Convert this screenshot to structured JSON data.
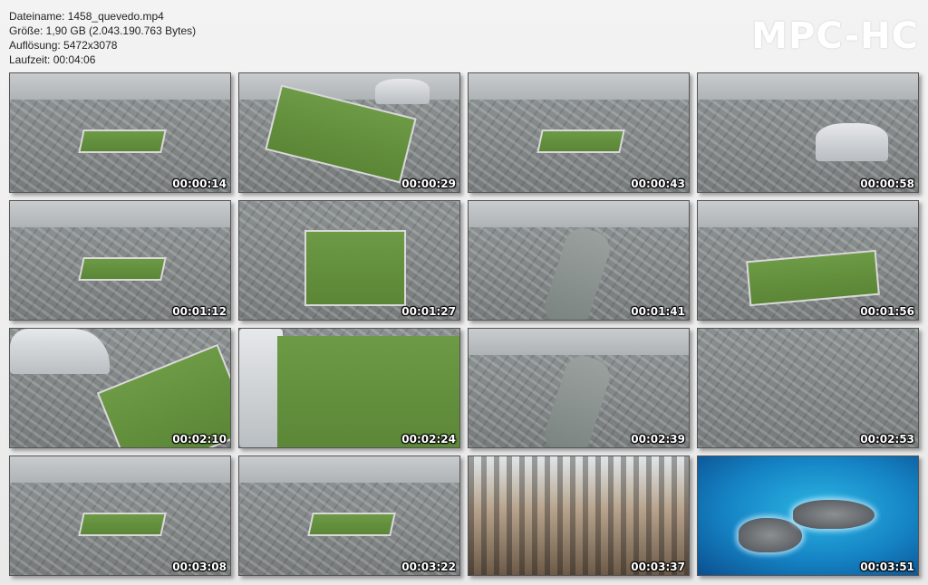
{
  "info": {
    "filename_line": "Dateiname: 1458_quevedo.mp4",
    "size_line": "Größe: 1,90 GB (2.043.190.763 Bytes)",
    "resolution_line": "Auflösung: 5472x3078",
    "duration_line": "Laufzeit: 00:04:06"
  },
  "logo": "MPC-HC",
  "thumbnails": [
    {
      "time": "00:00:14",
      "scene": "stadium-far"
    },
    {
      "time": "00:00:29",
      "scene": "stadium-close"
    },
    {
      "time": "00:00:43",
      "scene": "stadium-far"
    },
    {
      "time": "00:00:58",
      "scene": "arena-dome"
    },
    {
      "time": "00:01:12",
      "scene": "stadium-far"
    },
    {
      "time": "00:01:27",
      "scene": "stadium-top"
    },
    {
      "time": "00:01:41",
      "scene": "river"
    },
    {
      "time": "00:01:56",
      "scene": "stadium-tower"
    },
    {
      "time": "00:02:10",
      "scene": "arena-field"
    },
    {
      "time": "00:02:24",
      "scene": "field-close"
    },
    {
      "time": "00:02:39",
      "scene": "river"
    },
    {
      "time": "00:02:53",
      "scene": "rooftops"
    },
    {
      "time": "00:03:08",
      "scene": "stadium-far"
    },
    {
      "time": "00:03:22",
      "scene": "stadium-far"
    },
    {
      "time": "00:03:37",
      "scene": "skyscrapers"
    },
    {
      "time": "00:03:51",
      "scene": "island"
    }
  ]
}
